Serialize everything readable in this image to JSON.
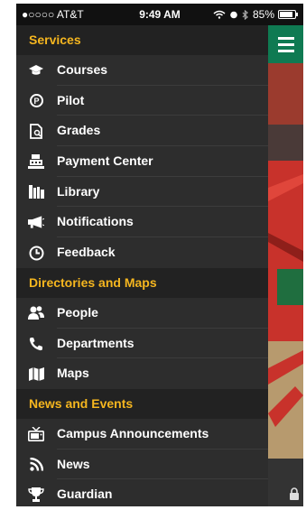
{
  "status_bar": {
    "carrier": "●○○○○ AT&T",
    "time": "9:49 AM",
    "battery": "85%",
    "battery_level": 0.85
  },
  "sections": [
    {
      "title": "Services",
      "items": [
        {
          "label": "Courses",
          "icon": "graduation-cap-icon"
        },
        {
          "label": "Pilot",
          "icon": "pilot-p-icon"
        },
        {
          "label": "Grades",
          "icon": "grades-document-icon"
        },
        {
          "label": "Payment Center",
          "icon": "cash-register-icon"
        },
        {
          "label": "Library",
          "icon": "books-icon"
        },
        {
          "label": "Notifications",
          "icon": "megaphone-icon"
        },
        {
          "label": "Feedback",
          "icon": "clock-icon"
        }
      ]
    },
    {
      "title": "Directories and Maps",
      "items": [
        {
          "label": "People",
          "icon": "people-icon"
        },
        {
          "label": "Departments",
          "icon": "phone-icon"
        },
        {
          "label": "Maps",
          "icon": "map-icon"
        }
      ]
    },
    {
      "title": "News and Events",
      "items": [
        {
          "label": "Campus Announcements",
          "icon": "tv-icon"
        },
        {
          "label": "News",
          "icon": "rss-icon"
        },
        {
          "label": "Guardian",
          "icon": "trophy-icon"
        }
      ]
    }
  ],
  "colors": {
    "section_header": "#f5b61f",
    "accent": "#0f7a52",
    "drawer_bg": "#2d2d2d"
  }
}
